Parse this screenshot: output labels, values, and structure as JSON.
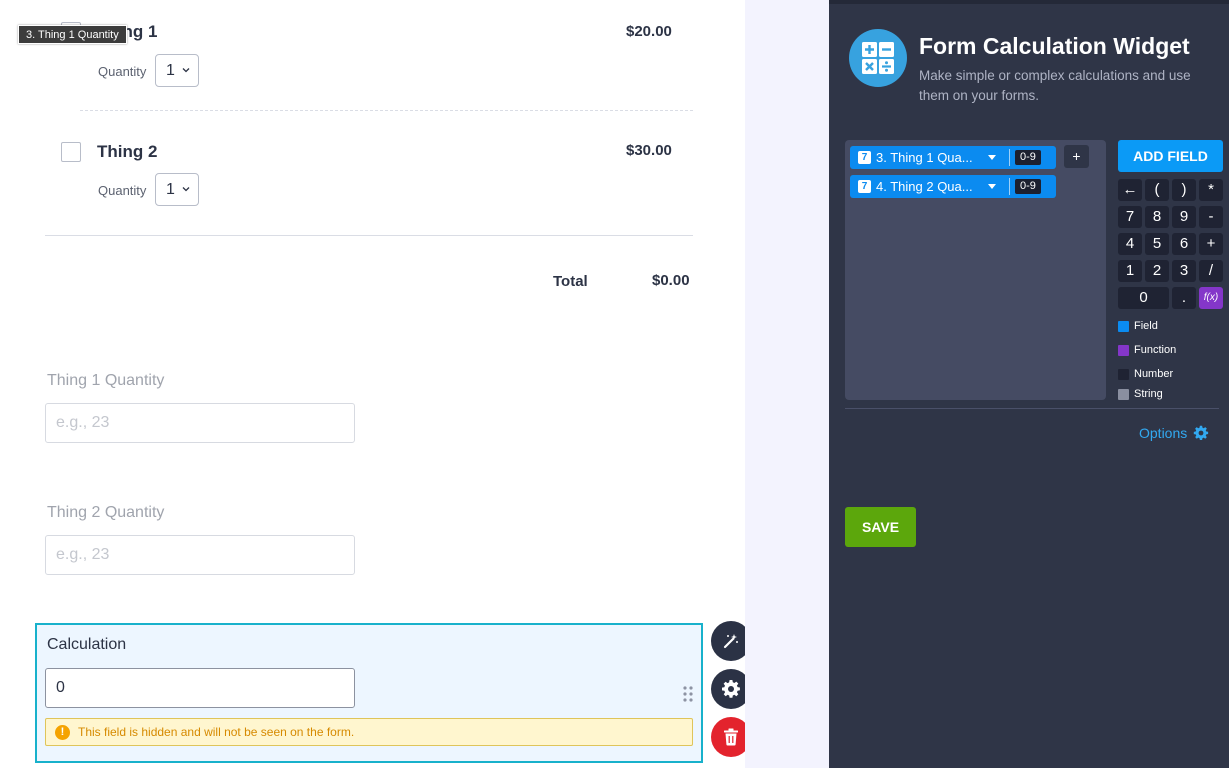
{
  "tooltip": {
    "text": "3. Thing 1 Quantity"
  },
  "products": [
    {
      "name": "Thing 1",
      "price": "$20.00",
      "quantity_label": "Quantity",
      "quantity_value": "1"
    },
    {
      "name": "Thing 2",
      "price": "$30.00",
      "quantity_label": "Quantity",
      "quantity_value": "1"
    }
  ],
  "total": {
    "label": "Total",
    "value": "$0.00"
  },
  "fields": [
    {
      "label": "Thing 1 Quantity",
      "placeholder": "e.g., 23"
    },
    {
      "label": "Thing 2 Quantity",
      "placeholder": "e.g., 23"
    }
  ],
  "calculation": {
    "label": "Calculation",
    "value": "0",
    "hidden_notice": "This field is hidden and will not be seen on the form.",
    "border_color": "#18b1cb"
  },
  "panel": {
    "title": "Form Calculation Widget",
    "description": "Make simple or complex calculations and use them on your forms.",
    "chips": [
      {
        "number": "7",
        "label": "3. Thing 1 Qua...",
        "range": "0-9"
      },
      {
        "number": "7",
        "label": "4. Thing 2 Qua...",
        "range": "0-9"
      }
    ],
    "add_chip_label": "+",
    "add_field_label": "ADD FIELD",
    "keypad": [
      [
        "←",
        "(",
        ")",
        "*"
      ],
      [
        "7",
        "8",
        "9",
        "-"
      ],
      [
        "4",
        "5",
        "6",
        "+"
      ],
      [
        "1",
        "2",
        "3",
        "/"
      ]
    ],
    "keypad_bottom": {
      "zero": "0",
      "dot": ".",
      "fx": "f(x)"
    },
    "legend": [
      {
        "label": "Field",
        "color": "#0b8bf0"
      },
      {
        "label": "Function",
        "color": "#8436c9"
      },
      {
        "label": "Number",
        "color": "#1f2333"
      },
      {
        "label": "String",
        "color": "#8a8fa0"
      }
    ],
    "options_label": "Options",
    "save_label": "SAVE"
  },
  "colors": {
    "accent_blue": "#0b9af6",
    "save_green": "#5ca70c",
    "delete_red": "#e3232d",
    "panel_bg": "#2f3547"
  }
}
